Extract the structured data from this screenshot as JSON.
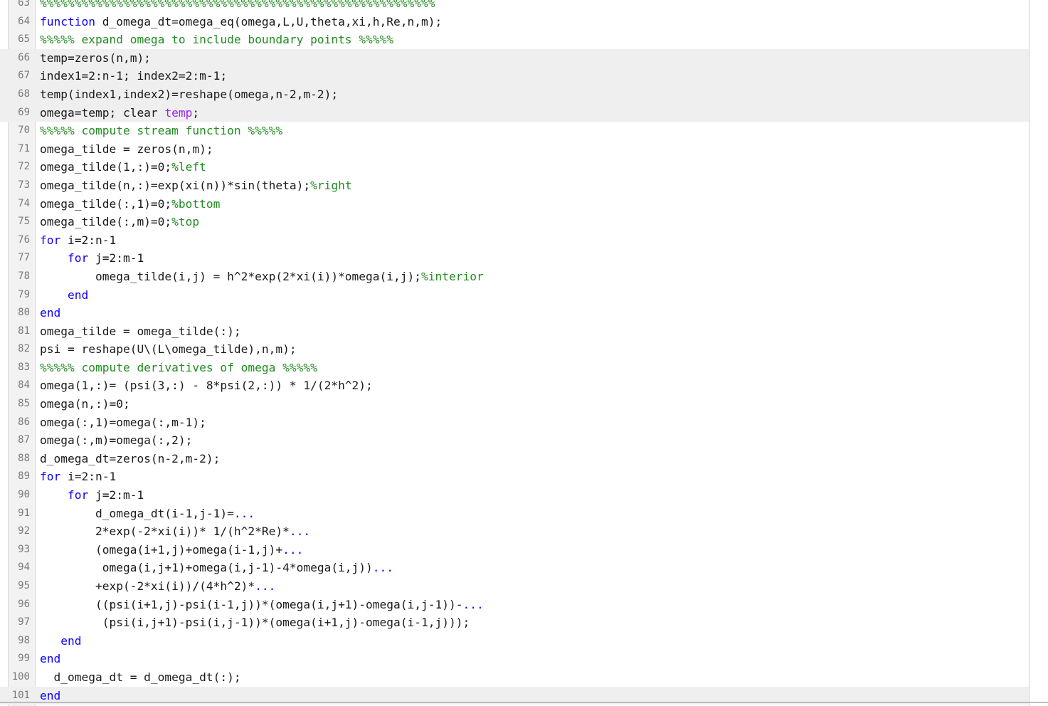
{
  "editor": {
    "lines": [
      {
        "num": "63",
        "hl": false,
        "tokens": [
          {
            "t": "%%%%%%%%%%%%%%%%%%%%%%%%%%%%%%%%%%%%%%%%%%%%%%%%%%%%%%%%%",
            "c": "cm"
          }
        ]
      },
      {
        "num": "64",
        "hl": false,
        "tokens": [
          {
            "t": "function",
            "c": "kw"
          },
          {
            "t": " d_omega_dt=omega_eq(omega,L,U,theta,xi,h,Re,n,m);",
            "c": ""
          }
        ]
      },
      {
        "num": "65",
        "hl": false,
        "tokens": [
          {
            "t": "%%%%% expand omega to include boundary points %%%%%",
            "c": "cm"
          }
        ]
      },
      {
        "num": "66",
        "hl": true,
        "tokens": [
          {
            "t": "temp=zeros(n,m);",
            "c": ""
          }
        ]
      },
      {
        "num": "67",
        "hl": true,
        "tokens": [
          {
            "t": "index1=2:n-1; index2=2:m-1;",
            "c": ""
          }
        ]
      },
      {
        "num": "68",
        "hl": true,
        "tokens": [
          {
            "t": "temp(index1,index2)=reshape(omega,n-2,m-2);",
            "c": ""
          }
        ]
      },
      {
        "num": "69",
        "hl": true,
        "tokens": [
          {
            "t": "omega=temp; clear ",
            "c": ""
          },
          {
            "t": "temp",
            "c": "str"
          },
          {
            "t": ";",
            "c": ""
          }
        ]
      },
      {
        "num": "70",
        "hl": false,
        "tokens": [
          {
            "t": "%%%%% compute stream function %%%%%",
            "c": "cm"
          }
        ]
      },
      {
        "num": "71",
        "hl": false,
        "tokens": [
          {
            "t": "omega_tilde = zeros(n,m);",
            "c": ""
          }
        ]
      },
      {
        "num": "72",
        "hl": false,
        "tokens": [
          {
            "t": "omega_tilde(1,:)=0;",
            "c": ""
          },
          {
            "t": "%left",
            "c": "cm"
          }
        ]
      },
      {
        "num": "73",
        "hl": false,
        "tokens": [
          {
            "t": "omega_tilde(n,:)=exp(xi(n))*sin(theta);",
            "c": ""
          },
          {
            "t": "%right",
            "c": "cm"
          }
        ]
      },
      {
        "num": "74",
        "hl": false,
        "tokens": [
          {
            "t": "omega_tilde(:,1)=0;",
            "c": ""
          },
          {
            "t": "%bottom",
            "c": "cm"
          }
        ]
      },
      {
        "num": "75",
        "hl": false,
        "tokens": [
          {
            "t": "omega_tilde(:,m)=0;",
            "c": ""
          },
          {
            "t": "%top",
            "c": "cm"
          }
        ]
      },
      {
        "num": "76",
        "hl": false,
        "tokens": [
          {
            "t": "for",
            "c": "kw"
          },
          {
            "t": " i=2:n-1",
            "c": ""
          }
        ]
      },
      {
        "num": "77",
        "hl": false,
        "tokens": [
          {
            "t": "    ",
            "c": ""
          },
          {
            "t": "for",
            "c": "kw"
          },
          {
            "t": " j=2:m-1",
            "c": ""
          }
        ]
      },
      {
        "num": "78",
        "hl": false,
        "tokens": [
          {
            "t": "        omega_tilde(i,j) = h^2*exp(2*xi(i))*omega(i,j);",
            "c": ""
          },
          {
            "t": "%interior",
            "c": "cm"
          }
        ]
      },
      {
        "num": "79",
        "hl": false,
        "tokens": [
          {
            "t": "    ",
            "c": ""
          },
          {
            "t": "end",
            "c": "kw"
          }
        ]
      },
      {
        "num": "80",
        "hl": false,
        "tokens": [
          {
            "t": "end",
            "c": "kw"
          }
        ]
      },
      {
        "num": "81",
        "hl": false,
        "tokens": [
          {
            "t": "omega_tilde = omega_tilde(:);",
            "c": ""
          }
        ]
      },
      {
        "num": "82",
        "hl": false,
        "tokens": [
          {
            "t": "psi = reshape(U\\(L\\omega_tilde),n,m);",
            "c": ""
          }
        ]
      },
      {
        "num": "83",
        "hl": false,
        "tokens": [
          {
            "t": "%%%%% compute derivatives of omega %%%%%",
            "c": "cm"
          }
        ]
      },
      {
        "num": "84",
        "hl": false,
        "tokens": [
          {
            "t": "omega(1,:)= (psi(3,:) - 8*psi(2,:)) * 1/(2*h^2);",
            "c": ""
          }
        ]
      },
      {
        "num": "85",
        "hl": false,
        "tokens": [
          {
            "t": "omega(n,:)=0;",
            "c": ""
          }
        ]
      },
      {
        "num": "86",
        "hl": false,
        "tokens": [
          {
            "t": "omega(:,1)=omega(:,m-1);",
            "c": ""
          }
        ]
      },
      {
        "num": "87",
        "hl": false,
        "tokens": [
          {
            "t": "omega(:,m)=omega(:,2);",
            "c": ""
          }
        ]
      },
      {
        "num": "88",
        "hl": false,
        "tokens": [
          {
            "t": "d_omega_dt=zeros(n-2,m-2);",
            "c": ""
          }
        ]
      },
      {
        "num": "89",
        "hl": false,
        "tokens": [
          {
            "t": "for",
            "c": "kw"
          },
          {
            "t": " i=2:n-1",
            "c": ""
          }
        ]
      },
      {
        "num": "90",
        "hl": false,
        "tokens": [
          {
            "t": "    ",
            "c": ""
          },
          {
            "t": "for",
            "c": "kw"
          },
          {
            "t": " j=2:m-1",
            "c": ""
          }
        ]
      },
      {
        "num": "91",
        "hl": false,
        "tokens": [
          {
            "t": "        d_omega_dt(i-1,j-1)=",
            "c": ""
          },
          {
            "t": "...",
            "c": "ell"
          }
        ]
      },
      {
        "num": "92",
        "hl": false,
        "tokens": [
          {
            "t": "        2*exp(-2*xi(i))* 1/(h^2*Re)*",
            "c": ""
          },
          {
            "t": "...",
            "c": "ell"
          }
        ]
      },
      {
        "num": "93",
        "hl": false,
        "tokens": [
          {
            "t": "        (omega(i+1,j)+omega(i-1,j)+",
            "c": ""
          },
          {
            "t": "...",
            "c": "ell"
          }
        ]
      },
      {
        "num": "94",
        "hl": false,
        "tokens": [
          {
            "t": "         omega(i,j+1)+omega(i,j-1)-4*omega(i,j))",
            "c": ""
          },
          {
            "t": "...",
            "c": "ell"
          }
        ]
      },
      {
        "num": "95",
        "hl": false,
        "tokens": [
          {
            "t": "        +exp(-2*xi(i))/(4*h^2)*",
            "c": ""
          },
          {
            "t": "...",
            "c": "ell"
          }
        ]
      },
      {
        "num": "96",
        "hl": false,
        "tokens": [
          {
            "t": "        ((psi(i+1,j)-psi(i-1,j))*(omega(i,j+1)-omega(i,j-1))-",
            "c": ""
          },
          {
            "t": "...",
            "c": "ell"
          }
        ]
      },
      {
        "num": "97",
        "hl": false,
        "tokens": [
          {
            "t": "         (psi(i,j+1)-psi(i,j-1))*(omega(i+1,j)-omega(i-1,j)));",
            "c": ""
          }
        ]
      },
      {
        "num": "98",
        "hl": false,
        "tokens": [
          {
            "t": "   ",
            "c": ""
          },
          {
            "t": "end",
            "c": "kw"
          }
        ]
      },
      {
        "num": "99",
        "hl": false,
        "tokens": [
          {
            "t": "end",
            "c": "kw"
          }
        ]
      },
      {
        "num": "100",
        "hl": false,
        "tokens": [
          {
            "t": "  d_omega_dt = d_omega_dt(:);",
            "c": ""
          }
        ]
      },
      {
        "num": "101",
        "hl": true,
        "tokens": [
          {
            "t": "end",
            "c": "kw"
          }
        ]
      }
    ]
  },
  "colors": {
    "keyword": "#0e00ff",
    "comment": "#228b22",
    "string": "#a020f0",
    "text": "#1a1a1a",
    "line_number": "#7a7a7a",
    "highlight": "#efefef"
  }
}
